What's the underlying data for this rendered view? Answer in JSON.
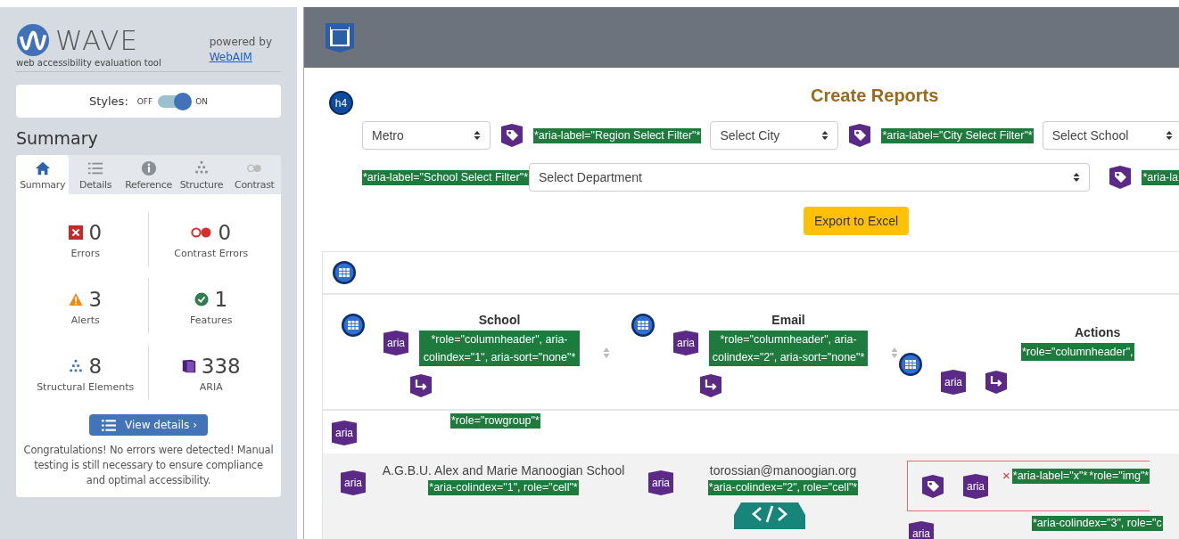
{
  "sidebar": {
    "logo": {
      "name": "WAVE",
      "tagline": "web accessibility evaluation tool"
    },
    "powered_by": "powered by",
    "powered_link": "WebAIM",
    "styles": {
      "label": "Styles:",
      "off_label": "OFF",
      "on_label": "ON",
      "on": true
    },
    "heading": "Summary",
    "tabs": [
      {
        "label": "Summary",
        "kind": "home",
        "selected": true
      },
      {
        "label": "Details",
        "kind": "list",
        "selected": false
      },
      {
        "label": "Reference",
        "kind": "info",
        "selected": false
      },
      {
        "label": "Structure",
        "kind": "structure",
        "selected": false
      },
      {
        "label": "Contrast",
        "kind": "contrast",
        "selected": false
      }
    ],
    "stats": [
      {
        "kind": "error",
        "count": "0",
        "label": "Errors"
      },
      {
        "kind": "contrast",
        "count": "0",
        "label": "Contrast Errors"
      },
      {
        "kind": "alert",
        "count": "3",
        "label": "Alerts"
      },
      {
        "kind": "feature",
        "count": "1",
        "label": "Features"
      },
      {
        "kind": "structure",
        "count": "8",
        "label": "Structural Elements"
      },
      {
        "kind": "aria",
        "count": "338",
        "label": "ARIA"
      }
    ],
    "details_button": "View details ›",
    "message": "Congratulations! No errors were detected! Manual testing is still necessary to ensure compliance and optimal accessibility."
  },
  "page": {
    "heading_badge": "h4",
    "title": "Create Reports",
    "filter_rows": [
      [
        {
          "kind": "select",
          "value": "Metro"
        },
        {
          "kind": "tag"
        },
        {
          "kind": "note",
          "text": "*aria-label=\"Region Select Filter\"*"
        },
        {
          "kind": "select",
          "value": "Select City"
        },
        {
          "kind": "tag"
        },
        {
          "kind": "note",
          "text": "*aria-label=\"City Select Filter\"*"
        },
        {
          "kind": "select",
          "value": "Select School",
          "wide": true
        }
      ],
      [
        {
          "kind": "note",
          "text": "*aria-label=\"School Select Filter\"*"
        },
        {
          "kind": "select",
          "value": "Select Department",
          "wide": true
        },
        {
          "kind": "tag"
        },
        {
          "kind": "note",
          "text": "*aria-la"
        }
      ]
    ],
    "export_button": "Export to Excel",
    "table": {
      "header_cells": [
        {
          "aria": "aria",
          "title": "School",
          "note": "*role=\"columnheader\", aria-colindex=\"1\", aria-sort=\"none\"*",
          "sortable": true
        },
        {
          "aria": "aria",
          "title": "Email",
          "note": "*role=\"columnheader\", aria-colindex=\"2\", aria-sort=\"none\"*",
          "sortable": true
        },
        {
          "aria": "aria",
          "title": "Actions",
          "note": "*role=\"columnheader\",",
          "sortable": false
        }
      ],
      "rowgroup": {
        "aria": "aria",
        "note": "*role=\"rowgroup\"*"
      },
      "row_cells": [
        {
          "aria": "aria",
          "text": "A.G.B.U. Alex and Marie Manoogian School",
          "note": "*aria-colindex=\"1\", role=\"cell\"*"
        },
        {
          "aria": "aria",
          "text": "torossian@manoogian.org",
          "note": "*aria-colindex=\"2\", role=\"cell\"*"
        }
      ],
      "error_box": {
        "aria": "aria",
        "mark": "×",
        "notes": [
          "*aria-label=\"x\"*",
          "*role=\"img\"*"
        ]
      },
      "below": {
        "aria": "aria",
        "note": "*aria-colindex=\"3\", role=\"c"
      }
    }
  }
}
